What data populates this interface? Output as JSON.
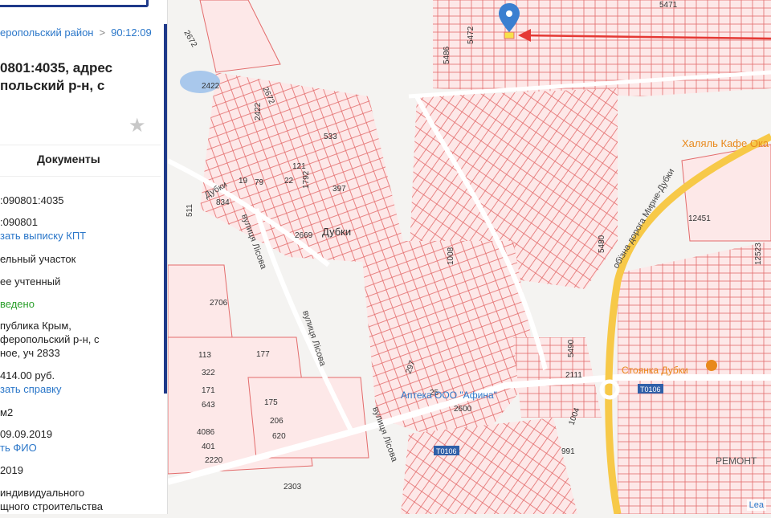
{
  "panel": {
    "breadcrumb": [
      "еропольский район",
      "90:12:09"
    ],
    "title_lines": [
      "0801:4035, адрес",
      "польский р-н, с"
    ],
    "documents_label": "Документы",
    "fields": [
      {
        "text": ":090801:4035"
      },
      {
        "text": ":090801"
      },
      {
        "text": "зать выписку КПТ",
        "link": true
      },
      {
        "text": "ельный участок"
      },
      {
        "text": "ее учтенный"
      },
      {
        "text": "ведено",
        "status": true
      },
      {
        "text": "публика Крым,"
      },
      {
        "text": "феропольский р-н, с"
      },
      {
        "text": "ное, уч 2833"
      },
      {
        "text": "414.00 руб."
      },
      {
        "text": "зать справку",
        "link": true
      },
      {
        "text": "м2"
      },
      {
        "text": "09.09.2019"
      },
      {
        "text": "ть ФИО",
        "link": true
      },
      {
        "text": "2019"
      },
      {
        "text": "индивидуального"
      },
      {
        "text": "щного строительства"
      }
    ]
  },
  "map": {
    "place_label": "Дубки",
    "road_labels": [
      "Дубки",
      "вулиця Лісова",
      "вулиця Лісова",
      "обїзна дорога Мирне-Дубки",
      "Т0106",
      "Т0106",
      "вулиця Лісова"
    ],
    "poi_labels": [
      "Халяль Кафе Ока",
      "Стоянка Дубки",
      "Аптека ООО \"Афина\"",
      "РЕМОНТ"
    ],
    "parcel_numbers": [
      "5471",
      "5486",
      "5472",
      "2672",
      "2422",
      "2672",
      "2422",
      "533",
      "121",
      "79",
      "19",
      "22",
      "397",
      "834",
      "511",
      "1792",
      "2669",
      "2706",
      "113",
      "177",
      "322",
      "171",
      "643",
      "175",
      "206",
      "620",
      "4086",
      "401",
      "2220",
      "2303",
      "2600",
      "991",
      "1004",
      "2111",
      "5490",
      "5480",
      "12451",
      "12523",
      "1008",
      "297",
      "25"
    ],
    "attribution": "Lea",
    "colors": {
      "parcel": "#e36b6b",
      "road": "#f7c948",
      "arrow": "#e53935",
      "marker": "#3a7fd0",
      "poi": "#e8891c"
    }
  }
}
